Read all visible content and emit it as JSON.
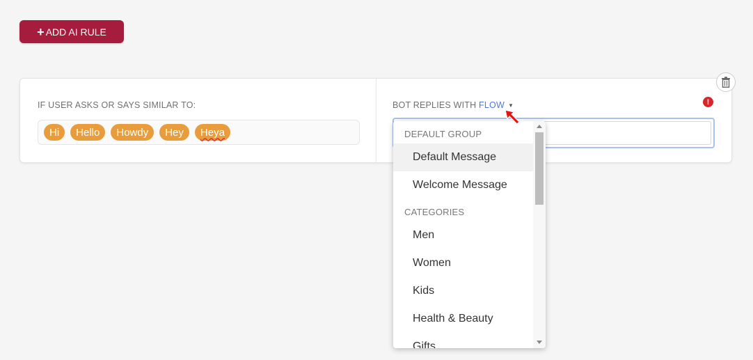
{
  "toolbar": {
    "add_rule_label": "ADD AI RULE",
    "add_rule_icon": "plus-icon"
  },
  "rule": {
    "left_label": "IF USER ASKS OR SAYS SIMILAR TO:",
    "phrases": [
      "Hi",
      "Hello",
      "Howdy",
      "Hey",
      "Heya"
    ],
    "right_label_prefix": "BOT REPLIES WITH",
    "reply_type": "FLOW",
    "reply_value": "",
    "error_icon": "!",
    "delete_icon": "trash-icon"
  },
  "dropdown": {
    "groups": [
      {
        "label": "DEFAULT GROUP",
        "items": [
          "Default Message",
          "Welcome Message"
        ]
      },
      {
        "label": "CATEGORIES",
        "items": [
          "Men",
          "Women",
          "Kids",
          "Health & Beauty",
          "Gifts"
        ]
      }
    ],
    "selected": "Default Message"
  },
  "colors": {
    "button": "#a51c3c",
    "tag": "#e89c3c",
    "link": "#4f78d6",
    "error": "#d7262b",
    "pointer": "#e81010"
  }
}
